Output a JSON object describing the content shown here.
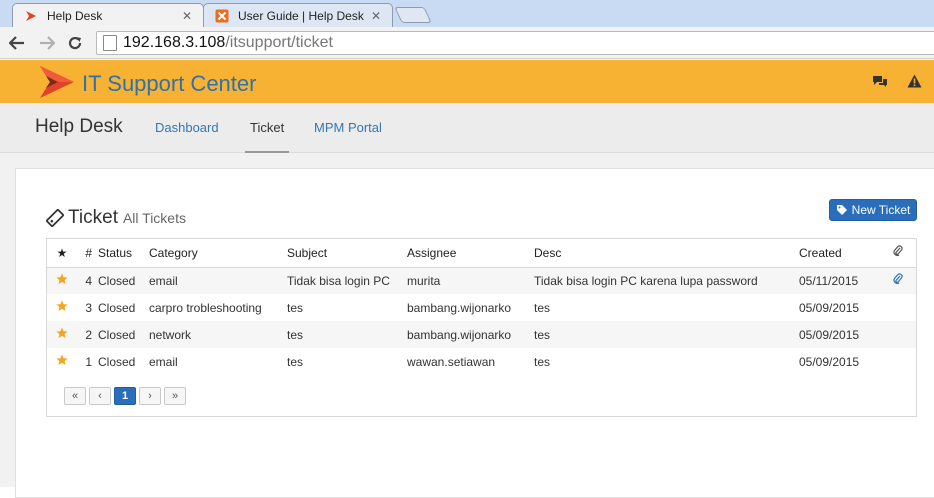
{
  "browser": {
    "tabs": [
      {
        "title": "Help Desk",
        "active": true
      },
      {
        "title": "User Guide | Help Desk",
        "active": false
      }
    ],
    "url_host": "192.168.3.108",
    "url_path": "/itsupport/ticket"
  },
  "header": {
    "app_title": "IT Support Center",
    "brand_color": "#f8b233",
    "title_color": "#3071a9"
  },
  "nav": {
    "brand": "Help Desk",
    "links": [
      {
        "label": "Dashboard",
        "active": false
      },
      {
        "label": "Ticket",
        "active": true
      },
      {
        "label": "MPM Portal",
        "active": false
      }
    ]
  },
  "page": {
    "title": "Ticket",
    "subtitle": "All Tickets",
    "new_ticket_label": "New Ticket"
  },
  "table": {
    "columns": {
      "star": "★",
      "num": "#",
      "status": "Status",
      "category": "Category",
      "subject": "Subject",
      "assignee": "Assignee",
      "desc": "Desc",
      "created": "Created"
    },
    "rows": [
      {
        "num": "4",
        "status": "Closed",
        "category": "email",
        "subject": "Tidak bisa login PC",
        "assignee": "murita",
        "desc": "Tidak bisa login PC karena lupa password",
        "created": "05/11/2015",
        "attachment": true
      },
      {
        "num": "3",
        "status": "Closed",
        "category": "carpro trobleshooting",
        "subject": "tes",
        "assignee": "bambang.wijonarko",
        "desc": "tes",
        "created": "05/09/2015",
        "attachment": false
      },
      {
        "num": "2",
        "status": "Closed",
        "category": "network",
        "subject": "tes",
        "assignee": "bambang.wijonarko",
        "desc": "tes",
        "created": "05/09/2015",
        "attachment": false
      },
      {
        "num": "1",
        "status": "Closed",
        "category": "email",
        "subject": "tes",
        "assignee": "wawan.setiawan",
        "desc": "tes",
        "created": "05/09/2015",
        "attachment": false
      }
    ]
  },
  "pager": {
    "first": "«",
    "prev": "‹",
    "current": "1",
    "next": "›",
    "last": "»"
  }
}
